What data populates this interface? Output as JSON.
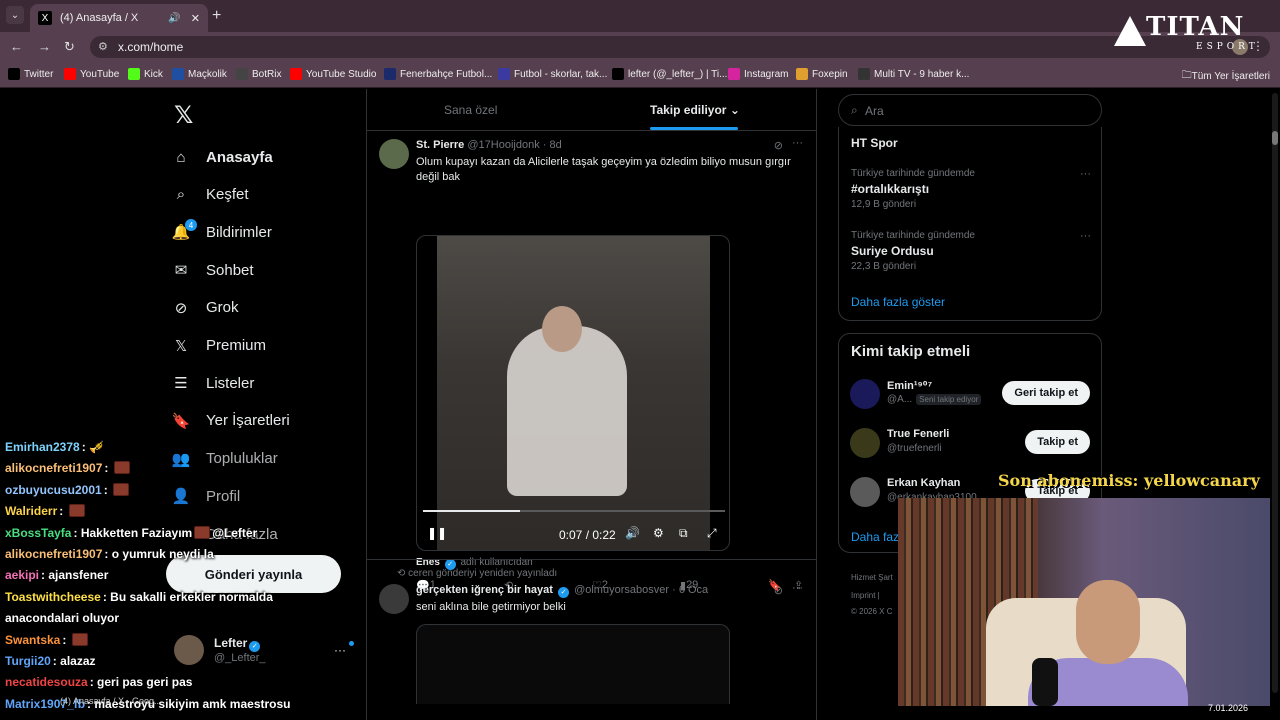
{
  "browser": {
    "tab_title": "(4) Anasayfa / X",
    "url": "x.com/home",
    "bookmarks": [
      {
        "label": "Twitter",
        "color": "#000000"
      },
      {
        "label": "YouTube",
        "color": "#ff0000"
      },
      {
        "label": "Kick",
        "color": "#53fc18"
      },
      {
        "label": "Maçkolik",
        "color": "#1f4fa0"
      },
      {
        "label": "BotRix",
        "color": "#444444"
      },
      {
        "label": "YouTube Studio",
        "color": "#ff0000"
      },
      {
        "label": "Fenerbahçe Futbol...",
        "color": "#1a2a6a"
      },
      {
        "label": "Futbol - skorlar, tak...",
        "color": "#3a3aa0"
      },
      {
        "label": "lefter (@_lefter_) | Ti...",
        "color": "#000000"
      },
      {
        "label": "Instagram",
        "color": "#d6249f"
      },
      {
        "label": "Foxepin",
        "color": "#e0a030"
      },
      {
        "label": "Multi TV - 9 haber k...",
        "color": "#333333"
      }
    ],
    "all_bookmarks": "Tüm Yer İşaretleri"
  },
  "nav": {
    "items": [
      {
        "label": "Anasayfa",
        "icon": "home-icon",
        "active": true
      },
      {
        "label": "Keşfet",
        "icon": "search-icon"
      },
      {
        "label": "Bildirimler",
        "icon": "bell-icon",
        "badge": "4"
      },
      {
        "label": "Sohbet",
        "icon": "mail-icon"
      },
      {
        "label": "Grok",
        "icon": "grok-icon"
      },
      {
        "label": "Premium",
        "icon": "x-icon"
      },
      {
        "label": "Listeler",
        "icon": "list-icon"
      },
      {
        "label": "Yer İşaretleri",
        "icon": "bookmark-icon"
      },
      {
        "label": "Topluluklar",
        "icon": "communities-icon"
      },
      {
        "label": "Profil",
        "icon": "person-icon"
      },
      {
        "label": "Daha fazla",
        "icon": "more-icon"
      }
    ],
    "post_button": "Gönderi yayınla",
    "account": {
      "name": "Lefter",
      "handle": "@_Lefter_"
    }
  },
  "timeline": {
    "tabs": [
      "Sana özel",
      "Takip ediliyor"
    ],
    "tweets": [
      {
        "name": "St. Pierre",
        "handle": "@17Hooijdonk",
        "time": "8d",
        "text": "Olum kupayı kazan da Alicilerle taşak geçeyim ya özledim biliyo musun gırgır değil bak",
        "video_time": "0:07 / 0:22",
        "video_progress": 0.32,
        "source_user": "Enes",
        "source_suffix": "adlı kullanıcıdan",
        "replies": "1",
        "reposts": "",
        "likes": "2",
        "views": "29"
      },
      {
        "retweeted_by": "ceren gönderiyi yeniden yayınladı",
        "name": "gerçekten iğrenç bir hayat",
        "handle": "@olmuyorsabosver",
        "time": "6 Oca",
        "text": "seni aklına bile getirmiyor belki"
      }
    ]
  },
  "right": {
    "search_placeholder": "Ara",
    "trends_top": "HT Spor",
    "trends": [
      {
        "context": "Türkiye tarihinde gündemde",
        "name": "#ortalıkkarıştı",
        "count": "12,9 B gönderi"
      },
      {
        "context": "Türkiye tarihinde gündemde",
        "name": "Suriye Ordusu",
        "count": "22,3 B gönderi"
      }
    ],
    "show_more": "Daha fazla göster",
    "who_to_follow": "Kimi takip etmeli",
    "suggestions": [
      {
        "name": "Emin¹⁹⁰⁷",
        "handle": "@A...",
        "follows_you": "Seni takip ediyor",
        "button": "Geri takip et"
      },
      {
        "name": "True Fenerli",
        "handle": "@truefenerli",
        "button": "Takip et"
      },
      {
        "name": "Erkan Kayhan",
        "handle": "@erkankayhan3100",
        "button": "Takip et"
      }
    ],
    "show_more_2": "Daha faz",
    "footer": [
      "Hizmet Şart",
      "Imprint |",
      "© 2026 X C"
    ]
  },
  "overlay": {
    "brand_big": "TITAN",
    "brand_small": "ESPORT",
    "sub_alert": "Son abonemiss: yellowcanary",
    "chat": [
      {
        "user": "Emirhan2378",
        "color": "#7dd3fc",
        "msg": " 🎺",
        "emote": false
      },
      {
        "user": "alikocnefreti1907",
        "color": "#fbbf77",
        "msg": "",
        "emote": true
      },
      {
        "user": "ozbuyucusu2001",
        "color": "#93c5fd",
        "msg": "",
        "emote": true
      },
      {
        "user": "Walriderr",
        "color": "#fcd34d",
        "msg": "",
        "emote": true
      },
      {
        "user": "xBossTayfa",
        "color": "#4ade80",
        "msg": "Hakketten Faziayım",
        "emote": true,
        "suffix": "@Lefter"
      },
      {
        "user": "alikocnefreti1907",
        "color": "#fbbf77",
        "msg": "o yumruk neydi la",
        "emote": false
      },
      {
        "user": "aekipi",
        "color": "#f472b6",
        "msg": "ajansfener",
        "emote": false
      },
      {
        "user": "Toastwithcheese",
        "color": "#fde047",
        "msg": "Bu sakalli erkekler normalda",
        "emote": false
      },
      {
        "user": "",
        "color": "#ffffff",
        "msg": "anacondalari oluyor",
        "emote": false
      },
      {
        "user": "Swantska",
        "color": "#fb923c",
        "msg": "",
        "emote": true
      },
      {
        "user": "Turgii20",
        "color": "#60a5fa",
        "msg": "alazaz",
        "emote": false
      },
      {
        "user": "necatidesouza",
        "color": "#ef4444",
        "msg": "geri pas geri pas",
        "emote": false
      },
      {
        "user": "Matrix1907_fb",
        "color": "#60a5fa",
        "msg": "maestroyu sikiyim amk maestrosu",
        "emote": false
      }
    ],
    "taskbar_item": "(4) Anasayfa / X - Goog...",
    "date": "7.01.2026"
  }
}
